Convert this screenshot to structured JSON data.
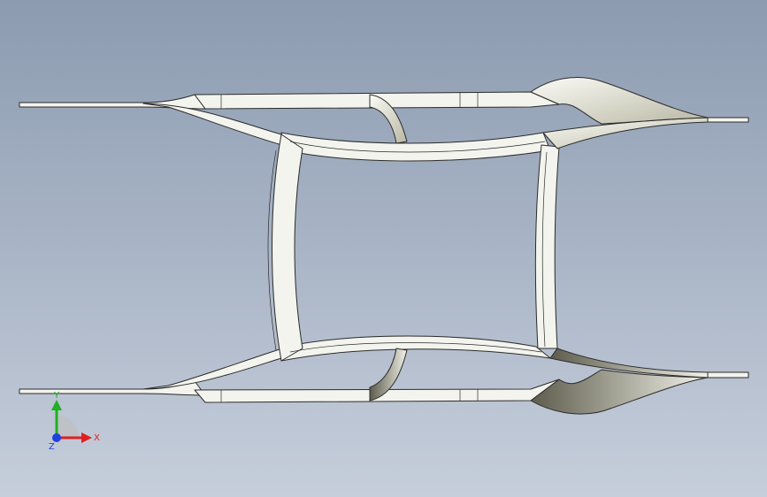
{
  "viewport": {
    "background_top": "#8c9bb0",
    "background_bottom": "#c6cedb"
  },
  "model": {
    "fill_color": "#f4f4ee",
    "shade_color": "#8b8a78",
    "edge_color": "#2b2b2b"
  },
  "triad": {
    "y_label": "Y",
    "x_label": "X",
    "z_label": "Z",
    "x_color": "#e02020",
    "y_color": "#20b020",
    "z_color": "#2040e0"
  }
}
